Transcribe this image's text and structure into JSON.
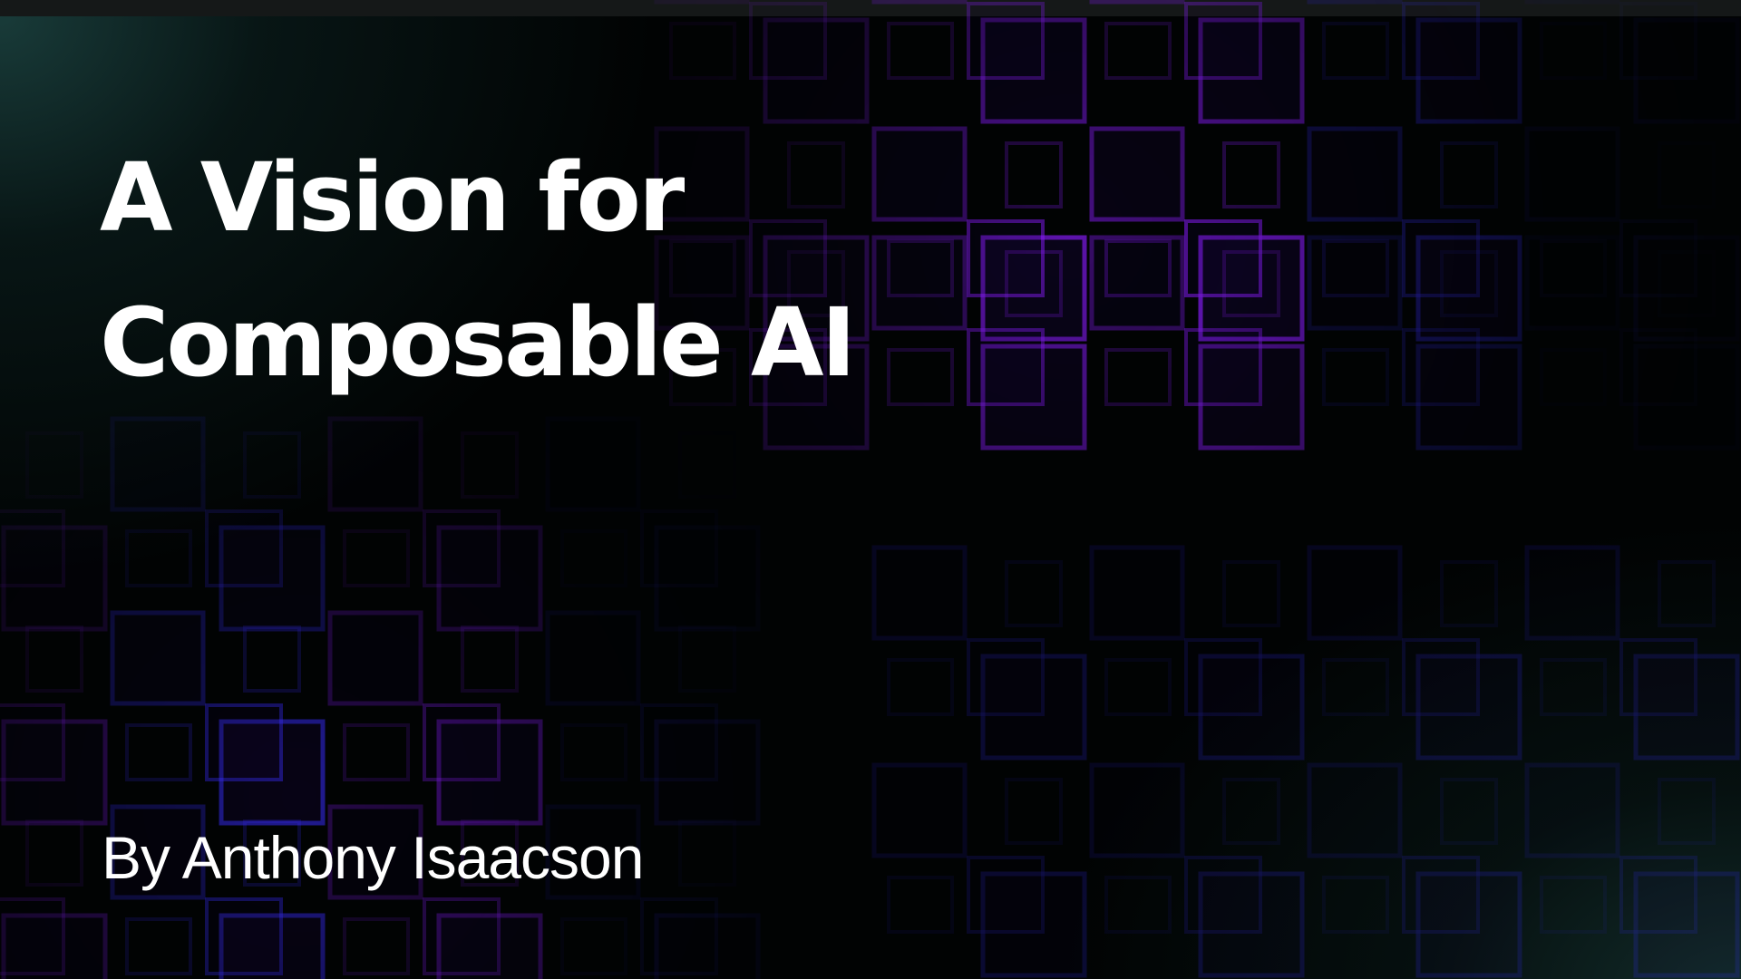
{
  "slide": {
    "title_line1": "A Vision for",
    "title_line2": "Composable AI",
    "author": "By Anthony Isaacson"
  },
  "theme": {
    "background": "#000000",
    "text_color": "#ffffff",
    "accent_purple": "#8a1cff",
    "accent_blue": "#3a2dff",
    "glow_teal": "#1a3e3c"
  }
}
